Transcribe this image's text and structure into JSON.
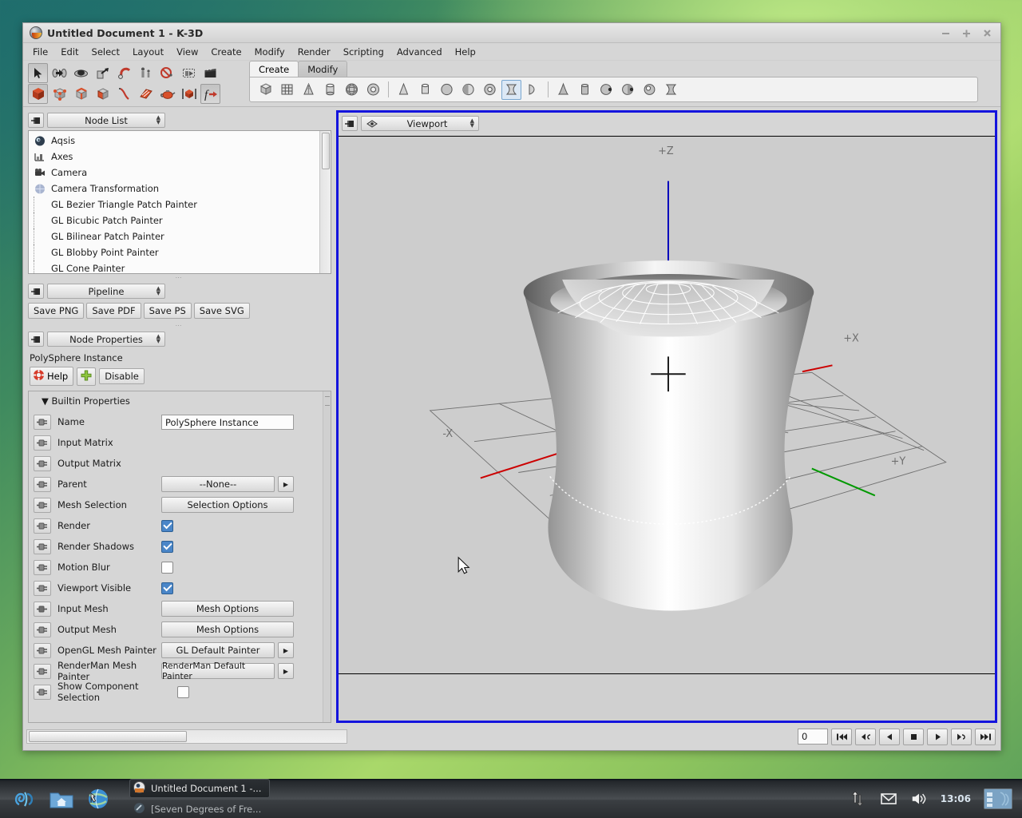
{
  "window": {
    "title": "Untitled Document 1 - K-3D",
    "controls": {
      "minimize": "minimize-button",
      "maximize": "maximize-button",
      "close": "close-button"
    }
  },
  "menubar": [
    "File",
    "Edit",
    "Select",
    "Layout",
    "View",
    "Create",
    "Modify",
    "Render",
    "Scripting",
    "Advanced",
    "Help"
  ],
  "toolbar": {
    "row1": [
      "select-tool-icon",
      "move-tool-icon",
      "rotate-tool-icon",
      "scale-tool-icon",
      "snap-tool-icon",
      "parent-tool-icon",
      "unparent-tool-icon",
      "render-preview-icon",
      "render-frame-icon"
    ],
    "row2": [
      "selection-node-icon",
      "selection-point-icon",
      "selection-line-icon",
      "selection-face-icon",
      "curve-icon",
      "patch-icon",
      "teapot-icon",
      "instance-icon",
      "function-icon"
    ]
  },
  "tabs": {
    "items": [
      "Create",
      "Modify"
    ],
    "active": "Create"
  },
  "create_palette": {
    "group1": [
      "cube-icon",
      "grid-icon",
      "cone-icon",
      "cylinder-icon",
      "sphere-icon",
      "torus-icon"
    ],
    "group2": [
      "poly-cone-icon",
      "poly-cylinder-icon",
      "poly-sphere-icon",
      "poly-disk-icon",
      "poly-torus-icon",
      "hyperboloid-icon",
      "paraboloid-icon"
    ],
    "group3": [
      "blobby-cone-icon",
      "blobby-cylinder-icon",
      "blobby-sphere-icon",
      "blobby-disk-icon",
      "blobby-torus-icon",
      "blobby-hyperboloid-icon"
    ],
    "selected": "hyperboloid-icon"
  },
  "node_list": {
    "panel_title": "Node List",
    "items": [
      {
        "label": "Aqsis",
        "icon": "aqsis-icon",
        "has_icon": true
      },
      {
        "label": "Axes",
        "icon": "axes-icon",
        "has_icon": true
      },
      {
        "label": "Camera",
        "icon": "camera-icon",
        "has_icon": true
      },
      {
        "label": "Camera Transformation",
        "icon": "transform-icon",
        "has_icon": true
      },
      {
        "label": "GL Bezier Triangle Patch Painter",
        "icon": "",
        "has_icon": false
      },
      {
        "label": "GL Bicubic Patch Painter",
        "icon": "",
        "has_icon": false
      },
      {
        "label": "GL Bilinear Patch Painter",
        "icon": "",
        "has_icon": false
      },
      {
        "label": "GL Blobby Point Painter",
        "icon": "",
        "has_icon": false
      },
      {
        "label": "GL Cone Painter",
        "icon": "",
        "has_icon": false
      }
    ]
  },
  "pipeline": {
    "panel_title": "Pipeline",
    "buttons": [
      "Save PNG",
      "Save PDF",
      "Save PS",
      "Save SVG"
    ]
  },
  "node_properties": {
    "panel_title": "Node Properties",
    "node_name": "PolySphere Instance",
    "help_label": "Help",
    "add_label": "add-property-button",
    "disable_label": "Disable",
    "group_label": "Builtin Properties",
    "rows": [
      {
        "label": "Name",
        "type": "text",
        "value": "PolySphere Instance"
      },
      {
        "label": "Input Matrix",
        "type": "none",
        "value": ""
      },
      {
        "label": "Output Matrix",
        "type": "none",
        "value": ""
      },
      {
        "label": "Parent",
        "type": "button-arrow",
        "value": "--None--"
      },
      {
        "label": "Mesh Selection",
        "type": "button",
        "value": "Selection Options"
      },
      {
        "label": "Render",
        "type": "checkbox",
        "value": true
      },
      {
        "label": "Render Shadows",
        "type": "checkbox",
        "value": true
      },
      {
        "label": "Motion Blur",
        "type": "checkbox",
        "value": false
      },
      {
        "label": "Viewport Visible",
        "type": "checkbox",
        "value": true
      },
      {
        "label": "Input Mesh",
        "type": "button",
        "value": "Mesh Options"
      },
      {
        "label": "Output Mesh",
        "type": "button",
        "value": "Mesh Options"
      },
      {
        "label": "OpenGL Mesh Painter",
        "type": "button-arrow",
        "value": "GL Default Painter"
      },
      {
        "label": "RenderMan Mesh Painter",
        "type": "button-arrow",
        "value": "RenderMan Default Painter"
      },
      {
        "label": "Show Component Selection",
        "type": "checkbox-inline",
        "value": false
      }
    ]
  },
  "viewport": {
    "panel_title": "Viewport",
    "axis_labels": {
      "plus_z": "+Z",
      "plus_x": "+X",
      "minus_x": "-X",
      "plus_y": "+Y"
    },
    "axis_colors": {
      "x": "#cc0000",
      "y": "#009900",
      "z": "#0000bb"
    },
    "background": "#cdcdcd",
    "object": "hyperboloid-mesh",
    "selection_border": "#1414dd"
  },
  "transport": {
    "frame_value": "0",
    "buttons": [
      "rewind-to-start-button",
      "step-back-button",
      "play-reverse-button",
      "stop-button",
      "play-button",
      "step-forward-button",
      "forward-to-end-button"
    ]
  },
  "taskbar": {
    "launchers": [
      "mandriva-menu-icon",
      "home-folder-icon",
      "web-browser-icon"
    ],
    "tasks": [
      {
        "label": "Untitled Document 1 -...",
        "active": true,
        "icon": "k3d-icon"
      },
      {
        "label": "[Seven Degrees of Fre...",
        "active": false,
        "icon": "doc-icon"
      }
    ],
    "tray": [
      "network-icon",
      "mail-icon",
      "volume-icon"
    ],
    "clock": "13:06",
    "pager": "workspace-pager"
  }
}
